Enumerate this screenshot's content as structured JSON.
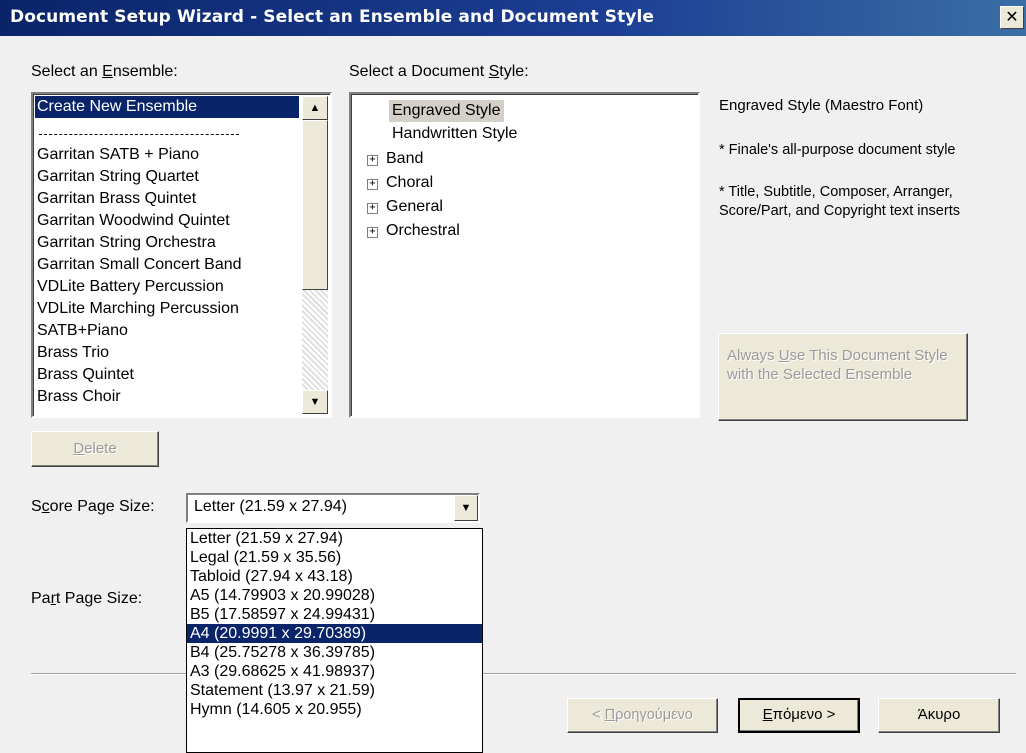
{
  "window": {
    "title": "Document Setup Wizard - Select an Ensemble and Document Style",
    "close_glyph": "✕"
  },
  "ensemble": {
    "label_pre": "Select an ",
    "label_mnemonic": "E",
    "label_post": "nsemble:",
    "items": [
      "Create New Ensemble",
      "Garritan SATB + Piano",
      "Garritan String Quartet",
      "Garritan Brass Quintet",
      "Garritan Woodwind Quintet",
      "Garritan String Orchestra",
      "Garritan Small Concert Band",
      "VDLite Battery Percussion",
      "VDLite Marching Percussion",
      "SATB+Piano",
      "Brass Trio",
      "Brass Quintet",
      "Brass Choir"
    ],
    "selected_index": 0
  },
  "style": {
    "label_pre": "Select a Document ",
    "label_mnemonic": "S",
    "label_post": "tyle:",
    "nodes": [
      {
        "label": "Engraved Style",
        "expandable": false
      },
      {
        "label": "Handwritten Style",
        "expandable": false
      },
      {
        "label": "Band",
        "expandable": true
      },
      {
        "label": "Choral",
        "expandable": true
      },
      {
        "label": "General",
        "expandable": true
      },
      {
        "label": "Orchestral",
        "expandable": true
      }
    ],
    "selected_index": 0
  },
  "description": {
    "title": "Engraved Style (Maestro Font)",
    "line1": "* Finale's all-purpose document style",
    "line2": "* Title, Subtitle, Composer, Arranger, Score/Part, and Copyright text inserts"
  },
  "always_use_button": {
    "pre": "Always ",
    "mnemonic": "U",
    "post": "se This Document Style with the Selected Ensemble"
  },
  "delete_button": {
    "mnemonic": "D",
    "post": "elete"
  },
  "score_page_size": {
    "label_pre": "S",
    "label_mnemonic": "c",
    "label_post": "ore Page Size:",
    "value": "Letter (21.59 x 27.94)",
    "options": [
      "Letter (21.59 x 27.94)",
      "Legal (21.59 x 35.56)",
      "Tabloid (27.94 x 43.18)",
      "A5 (14.79903 x 20.99028)",
      "B5 (17.58597 x 24.99431)",
      "A4 (20.9991 x 29.70389)",
      "B4 (25.75278 x 36.39785)",
      "A3 (29.68625 x 41.98937)",
      "Statement (13.97 x 21.59)",
      "Hymn (14.605 x 20.955)"
    ],
    "highlighted_index": 5
  },
  "part_page_size": {
    "label_pre": "Pa",
    "label_mnemonic": "r",
    "label_post": "t Page Size:"
  },
  "nav": {
    "back": {
      "pre": "< ",
      "mnemonic": "Π",
      "post": "ροηγούμενο"
    },
    "next": {
      "mnemonic": "Ε",
      "post": "πόμενο >"
    },
    "cancel": "Άκυρο"
  }
}
